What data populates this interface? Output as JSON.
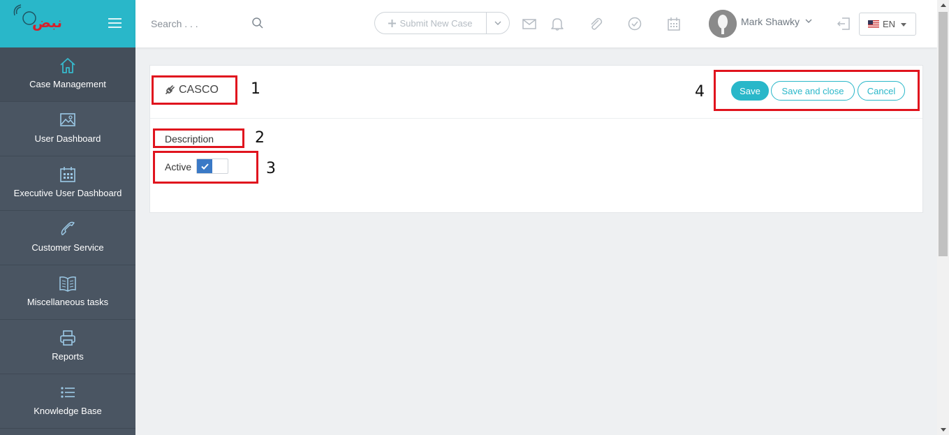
{
  "app": {
    "logo_text": "نبض"
  },
  "sidebar": {
    "items": [
      {
        "label": "Case Management",
        "icon": "home-icon"
      },
      {
        "label": "User Dashboard",
        "icon": "image-icon"
      },
      {
        "label": "Executive User Dashboard",
        "icon": "calendar-icon"
      },
      {
        "label": "Customer Service",
        "icon": "phone-icon"
      },
      {
        "label": "Miscellaneous tasks",
        "icon": "book-icon"
      },
      {
        "label": "Reports",
        "icon": "printer-icon"
      },
      {
        "label": "Knowledge Base",
        "icon": "list-icon"
      }
    ]
  },
  "topbar": {
    "search_placeholder": "Search . . .",
    "submit_label": "Submit New Case",
    "user_name": "Mark Shawky",
    "language": "EN"
  },
  "form": {
    "title": "CASCO",
    "description_label": "Description",
    "active_label": "Active",
    "active_checked": true,
    "buttons": {
      "save": "Save",
      "save_close": "Save and close",
      "cancel": "Cancel"
    }
  },
  "annotations": [
    "1",
    "2",
    "3",
    "4"
  ],
  "colors": {
    "accent": "#29b7c9",
    "sidebar": "#4a5562",
    "highlight": "#e0141e",
    "toggle": "#3a79c6"
  }
}
